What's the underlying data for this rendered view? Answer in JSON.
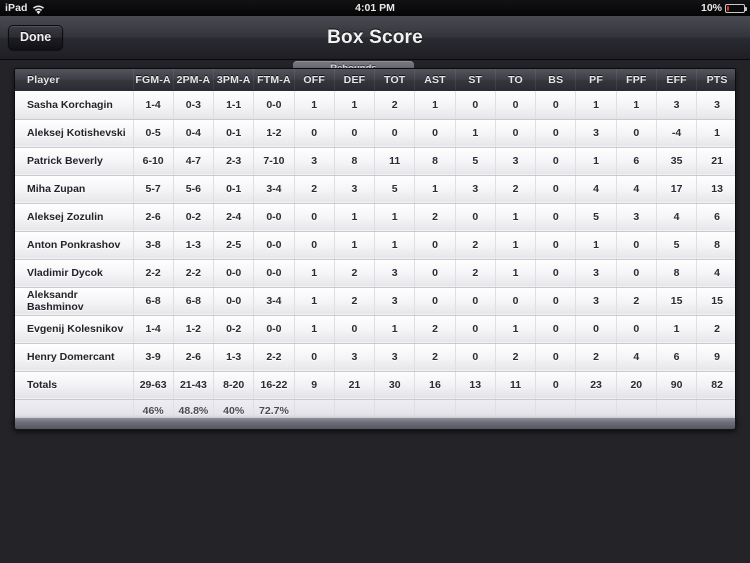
{
  "statusbar": {
    "device": "iPad",
    "wifi_icon": "wifi-icon",
    "time": "4:01 PM",
    "battery_percent": "10%",
    "battery_icon": "battery-icon",
    "battery_color": "#d8342a"
  },
  "navbar": {
    "done_label": "Done",
    "title": "Box Score"
  },
  "group_header": {
    "label": "Rebounds"
  },
  "table": {
    "columns": [
      "Player",
      "FGM-A",
      "2PM-A",
      "3PM-A",
      "FTM-A",
      "OFF",
      "DEF",
      "TOT",
      "AST",
      "ST",
      "TO",
      "BS",
      "PF",
      "FPF",
      "EFF",
      "PTS"
    ],
    "rows": [
      [
        "Sasha Korchagin",
        "1-4",
        "0-3",
        "1-1",
        "0-0",
        "1",
        "1",
        "2",
        "1",
        "0",
        "0",
        "0",
        "1",
        "1",
        "3",
        "3"
      ],
      [
        "Aleksej Kotishevski",
        "0-5",
        "0-4",
        "0-1",
        "1-2",
        "0",
        "0",
        "0",
        "0",
        "1",
        "0",
        "0",
        "3",
        "0",
        "-4",
        "1"
      ],
      [
        "Patrick Beverly",
        "6-10",
        "4-7",
        "2-3",
        "7-10",
        "3",
        "8",
        "11",
        "8",
        "5",
        "3",
        "0",
        "1",
        "6",
        "35",
        "21"
      ],
      [
        "Miha Zupan",
        "5-7",
        "5-6",
        "0-1",
        "3-4",
        "2",
        "3",
        "5",
        "1",
        "3",
        "2",
        "0",
        "4",
        "4",
        "17",
        "13"
      ],
      [
        "Aleksej Zozulin",
        "2-6",
        "0-2",
        "2-4",
        "0-0",
        "0",
        "1",
        "1",
        "2",
        "0",
        "1",
        "0",
        "5",
        "3",
        "4",
        "6"
      ],
      [
        "Anton Ponkrashov",
        "3-8",
        "1-3",
        "2-5",
        "0-0",
        "0",
        "1",
        "1",
        "0",
        "2",
        "1",
        "0",
        "1",
        "0",
        "5",
        "8"
      ],
      [
        "Vladimir Dycok",
        "2-2",
        "2-2",
        "0-0",
        "0-0",
        "1",
        "2",
        "3",
        "0",
        "2",
        "1",
        "0",
        "3",
        "0",
        "8",
        "4"
      ],
      [
        "Aleksandr Bashminov",
        "6-8",
        "6-8",
        "0-0",
        "3-4",
        "1",
        "2",
        "3",
        "0",
        "0",
        "0",
        "0",
        "3",
        "2",
        "15",
        "15"
      ],
      [
        "Evgenij Kolesnikov",
        "1-4",
        "1-2",
        "0-2",
        "0-0",
        "1",
        "0",
        "1",
        "2",
        "0",
        "1",
        "0",
        "0",
        "0",
        "1",
        "2"
      ],
      [
        "Henry Domercant",
        "3-9",
        "2-6",
        "1-3",
        "2-2",
        "0",
        "3",
        "3",
        "2",
        "0",
        "2",
        "0",
        "2",
        "4",
        "6",
        "9"
      ]
    ],
    "totals_row": [
      "Totals",
      "29-63",
      "21-43",
      "8-20",
      "16-22",
      "9",
      "21",
      "30",
      "16",
      "13",
      "11",
      "0",
      "23",
      "20",
      "90",
      "82"
    ],
    "percent_row": [
      "",
      "46%",
      "48.8%",
      "40%",
      "72.7%",
      "",
      "",
      "",
      "",
      "",
      "",
      "",
      "",
      "",
      "",
      ""
    ]
  }
}
